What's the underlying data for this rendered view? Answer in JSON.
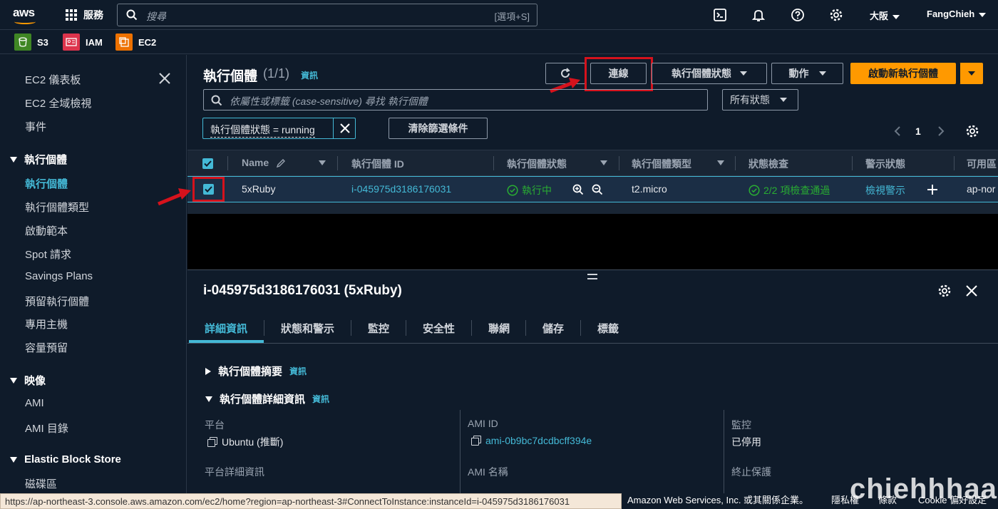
{
  "topnav": {
    "logo": "aws",
    "services_label": "服務",
    "search_placeholder": "搜尋",
    "search_shortcut": "[選項+S]",
    "region": "大阪",
    "user": "FangChieh"
  },
  "favorites": [
    {
      "label": "S3",
      "color": "#3f8624"
    },
    {
      "label": "IAM",
      "color": "#dd344c"
    },
    {
      "label": "EC2",
      "color": "#ed7100"
    }
  ],
  "sidebar": {
    "items": [
      {
        "label": "EC2 儀表板"
      },
      {
        "label": "EC2 全域檢視"
      },
      {
        "label": "事件"
      }
    ],
    "section_instances": "執行個體",
    "instance_items": [
      {
        "label": "執行個體"
      },
      {
        "label": "執行個體類型"
      },
      {
        "label": "啟動範本"
      },
      {
        "label": "Spot 請求"
      },
      {
        "label": "Savings Plans"
      },
      {
        "label": "預留執行個體"
      },
      {
        "label": "專用主機"
      },
      {
        "label": "容量預留"
      }
    ],
    "section_images": "映像",
    "image_items": [
      {
        "label": "AMI"
      },
      {
        "label": "AMI 目錄"
      }
    ],
    "section_ebs": "Elastic Block Store",
    "ebs_items": [
      {
        "label": "磁碟區"
      }
    ]
  },
  "main": {
    "title": "執行個體",
    "count": "(1/1)",
    "info": "資訊",
    "connect_button": "連線",
    "state_button": "執行個體狀態",
    "actions_button": "動作",
    "launch_button": "啟動新執行個體",
    "filter_placeholder": "依屬性或標籤 (case-sensitive) 尋找 執行個體",
    "status_select": "所有狀態",
    "filter_chip": "執行個體狀態 = running",
    "clear_filters": "清除篩選條件",
    "page_number": "1"
  },
  "table": {
    "headers": {
      "name": "Name",
      "instance_id": "執行個體 ID",
      "state": "執行個體狀態",
      "type": "執行個體類型",
      "status_check": "狀態檢查",
      "alarm": "警示狀態",
      "az": "可用區"
    },
    "rows": [
      {
        "name": "5xRuby",
        "instance_id": "i-045975d3186176031",
        "state": "執行中",
        "type": "t2.micro",
        "status_check": "2/2 項檢查通過",
        "alarm": "檢視警示",
        "az": "ap-nor"
      }
    ]
  },
  "detail": {
    "title": "i-045975d3186176031 (5xRuby)",
    "tabs": [
      "詳細資訊",
      "狀態和警示",
      "監控",
      "安全性",
      "聯網",
      "儲存",
      "標籤"
    ],
    "section_summary": "執行個體摘要",
    "section_details": "執行個體詳細資訊",
    "info": "資訊",
    "platform_label": "平台",
    "platform_value": "Ubuntu (推斷)",
    "platform_detail_label": "平台詳細資訊",
    "ami_id_label": "AMI ID",
    "ami_id_value": "ami-0b9bc7dcdbcff394e",
    "ami_name_label": "AMI 名稱",
    "monitoring_label": "監控",
    "monitoring_value": "已停用",
    "termination_label": "終止保護"
  },
  "footer": {
    "status_url": "https://ap-northeast-3.console.aws.amazon.com/ec2/home?region=ap-northeast-3#ConnectToInstance:instanceId=i-045975d3186176031",
    "copyright": "Amazon Web Services, Inc. 或其關係企業。",
    "privacy": "隱私權",
    "terms": "條款",
    "cookie": "Cookie 偏好設定",
    "watermark": "chiehhhaa"
  },
  "colors": {
    "accent": "#44b9d6",
    "primary": "#ff9900",
    "highlight": "#d5121c",
    "success": "#29ad32"
  }
}
